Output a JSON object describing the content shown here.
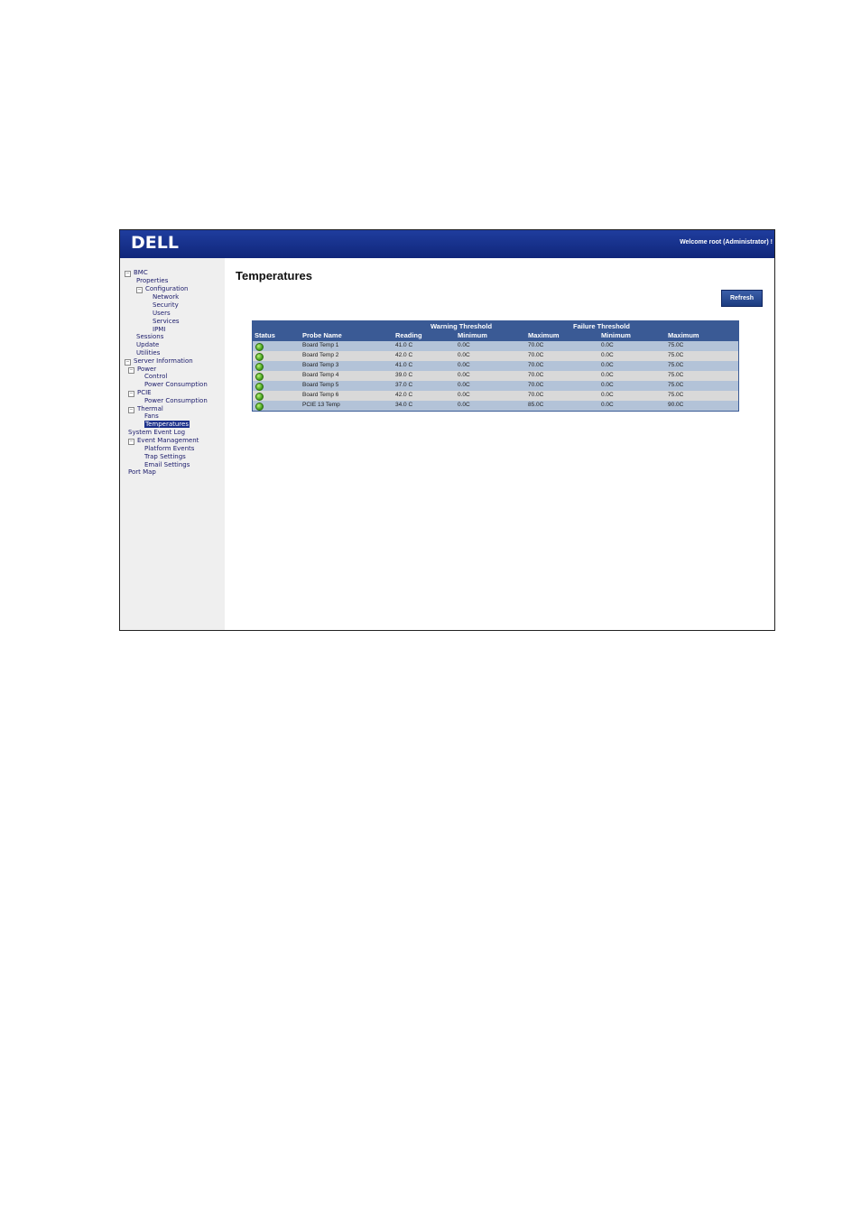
{
  "header": {
    "logo": "DELL",
    "welcome": "Welcome root (Administrator) !"
  },
  "sidebar": {
    "items": [
      {
        "label": "BMC",
        "toggle": "⊟"
      },
      {
        "label": "Properties"
      },
      {
        "label": "Configuration",
        "toggle": "⊟"
      },
      {
        "label": "Network"
      },
      {
        "label": "Security"
      },
      {
        "label": "Users"
      },
      {
        "label": "Services"
      },
      {
        "label": "IPMI"
      },
      {
        "label": "Sessions"
      },
      {
        "label": "Update"
      },
      {
        "label": "Utilities"
      },
      {
        "label": "Server Information",
        "toggle": "⊟"
      },
      {
        "label": "Power",
        "toggle": "⊟"
      },
      {
        "label": "Control"
      },
      {
        "label": "Power Consumption"
      },
      {
        "label": "PCIE",
        "toggle": "⊟"
      },
      {
        "label": "Power Consumption"
      },
      {
        "label": "Thermal",
        "toggle": "⊟"
      },
      {
        "label": "Fans"
      },
      {
        "label": "Temperatures",
        "selected": true
      },
      {
        "label": "System Event Log"
      },
      {
        "label": "Event Management",
        "toggle": "⊟"
      },
      {
        "label": "Platform Events"
      },
      {
        "label": "Trap Settings"
      },
      {
        "label": "Email Settings"
      },
      {
        "label": "Port Map"
      }
    ]
  },
  "main": {
    "title": "Temperatures",
    "refresh_label": "Refresh",
    "table": {
      "group_headers": {
        "warning": "Warning Threshold",
        "failure": "Failure Threshold"
      },
      "columns": {
        "status": "Status",
        "probe": "Probe Name",
        "reading": "Reading",
        "warn_min": "Minimum",
        "warn_max": "Maximum",
        "fail_min": "Minimum",
        "fail_max": "Maximum"
      },
      "rows": [
        {
          "probe": "Board Temp 1",
          "reading": "41.0 C",
          "warn_min": "0.0C",
          "warn_max": "70.0C",
          "fail_min": "0.0C",
          "fail_max": "75.0C"
        },
        {
          "probe": "Board Temp 2",
          "reading": "42.0 C",
          "warn_min": "0.0C",
          "warn_max": "70.0C",
          "fail_min": "0.0C",
          "fail_max": "75.0C"
        },
        {
          "probe": "Board Temp 3",
          "reading": "41.0 C",
          "warn_min": "0.0C",
          "warn_max": "70.0C",
          "fail_min": "0.0C",
          "fail_max": "75.0C"
        },
        {
          "probe": "Board Temp 4",
          "reading": "39.0 C",
          "warn_min": "0.0C",
          "warn_max": "70.0C",
          "fail_min": "0.0C",
          "fail_max": "75.0C"
        },
        {
          "probe": "Board Temp 5",
          "reading": "37.0 C",
          "warn_min": "0.0C",
          "warn_max": "70.0C",
          "fail_min": "0.0C",
          "fail_max": "75.0C"
        },
        {
          "probe": "Board Temp 6",
          "reading": "42.0 C",
          "warn_min": "0.0C",
          "warn_max": "70.0C",
          "fail_min": "0.0C",
          "fail_max": "75.0C"
        },
        {
          "probe": "PCIE 13 Temp",
          "reading": "34.0 C",
          "warn_min": "0.0C",
          "warn_max": "85.0C",
          "fail_min": "0.0C",
          "fail_max": "90.0C"
        }
      ]
    }
  },
  "colors": {
    "header_bg": "#1a3390",
    "table_header_bg": "#3a5a95",
    "row_odd": "#b3c3d8",
    "row_even": "#d9d9d9",
    "status_ok": "#3d9a17"
  },
  "icons": {
    "status": "status-ok-icon",
    "tree_toggle": "collapse-toggle-icon"
  }
}
